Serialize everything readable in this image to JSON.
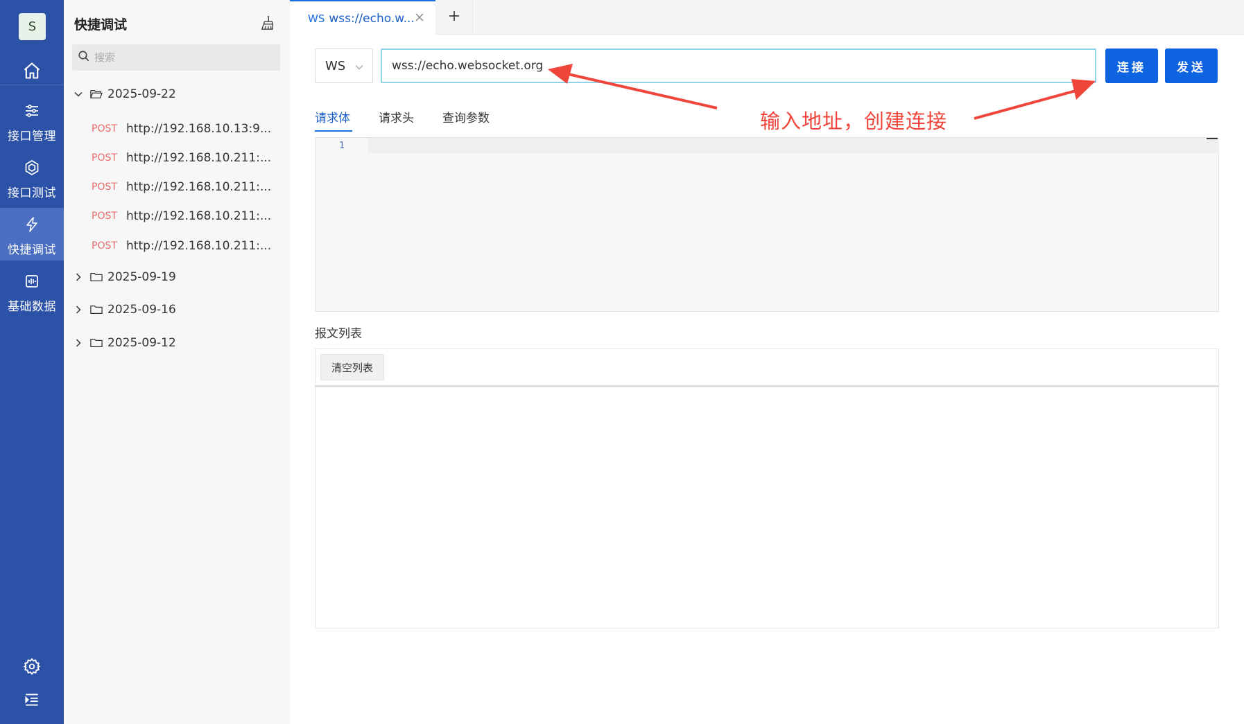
{
  "nav": {
    "avatar": "S",
    "items": [
      {
        "label": "接口管理",
        "icon": "sliders-icon"
      },
      {
        "label": "接口测试",
        "icon": "hexagon-icon"
      },
      {
        "label": "快捷调试",
        "icon": "lightning-icon"
      },
      {
        "label": "基础数据",
        "icon": "data-icon"
      }
    ]
  },
  "tree": {
    "title": "快捷调试",
    "search_placeholder": "搜索",
    "folders": [
      {
        "date": "2025-09-22",
        "expanded": true
      },
      {
        "date": "2025-09-19",
        "expanded": false
      },
      {
        "date": "2025-09-16",
        "expanded": false
      },
      {
        "date": "2025-09-12",
        "expanded": false
      }
    ],
    "requests": [
      {
        "method": "POST",
        "url": "http://192.168.10.13:9..."
      },
      {
        "method": "POST",
        "url": "http://192.168.10.211:..."
      },
      {
        "method": "POST",
        "url": "http://192.168.10.211:..."
      },
      {
        "method": "POST",
        "url": "http://192.168.10.211:..."
      },
      {
        "method": "POST",
        "url": "http://192.168.10.211:..."
      }
    ]
  },
  "tabs": {
    "active": {
      "type": "WS",
      "name": "wss://echo.w..."
    }
  },
  "request": {
    "protocol": "WS",
    "url": "wss://echo.websocket.org",
    "connect_label": "连接",
    "send_label": "发送"
  },
  "subtabs": [
    "请求体",
    "请求头",
    "查询参数"
  ],
  "editor": {
    "line": "1"
  },
  "messages": {
    "title": "报文列表",
    "clear_label": "清空列表"
  },
  "annotation": {
    "text": "输入地址，创建连接",
    "color": "#f0453b"
  },
  "colors": {
    "nav_bg": "#2c52a8",
    "primary": "#0d63e0",
    "post": "#e86a6a"
  }
}
